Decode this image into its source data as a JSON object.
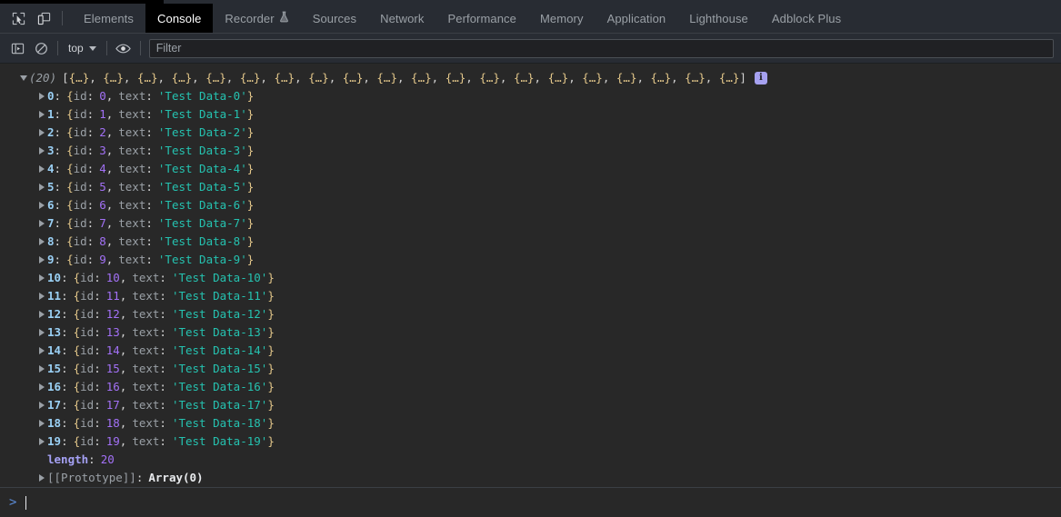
{
  "window": {
    "clipped_top_text": "······ ···· ········ ········ ······ ······ · ···· ········· ·· ·· ········ ····· ·······"
  },
  "tabbar": {
    "icons": [
      {
        "name": "inspect-element-icon",
        "label": "Inspect element"
      },
      {
        "name": "device-toolbar-icon",
        "label": "Toggle device toolbar"
      }
    ],
    "tabs": [
      {
        "label": "Elements",
        "active": false,
        "badge": ""
      },
      {
        "label": "Console",
        "active": true,
        "badge": ""
      },
      {
        "label": "Recorder",
        "active": false,
        "badge": "flask-icon"
      },
      {
        "label": "Sources",
        "active": false,
        "badge": ""
      },
      {
        "label": "Network",
        "active": false,
        "badge": ""
      },
      {
        "label": "Performance",
        "active": false,
        "badge": ""
      },
      {
        "label": "Memory",
        "active": false,
        "badge": ""
      },
      {
        "label": "Application",
        "active": false,
        "badge": ""
      },
      {
        "label": "Lighthouse",
        "active": false,
        "badge": ""
      },
      {
        "label": "Adblock Plus",
        "active": false,
        "badge": ""
      }
    ]
  },
  "toolbar": {
    "sidebar_toggle_icon": "show-console-sidebar-icon",
    "clear_icon": "clear-console-icon",
    "context_label": "top",
    "eye_icon": "create-live-expression-icon",
    "filter_placeholder": "Filter",
    "filter_value": ""
  },
  "console": {
    "array_header": {
      "count": "(20)",
      "open_bracket": "[",
      "close_bracket": "]",
      "preview_item": "{…}",
      "preview_separator": ", ",
      "preview_count": 20,
      "visible_preview_count": 20,
      "info_badge": "i",
      "expanded": true
    },
    "rows": [
      {
        "index": "0",
        "id": "0",
        "text": "Test Data-0"
      },
      {
        "index": "1",
        "id": "1",
        "text": "Test Data-1"
      },
      {
        "index": "2",
        "id": "2",
        "text": "Test Data-2"
      },
      {
        "index": "3",
        "id": "3",
        "text": "Test Data-3"
      },
      {
        "index": "4",
        "id": "4",
        "text": "Test Data-4"
      },
      {
        "index": "5",
        "id": "5",
        "text": "Test Data-5"
      },
      {
        "index": "6",
        "id": "6",
        "text": "Test Data-6"
      },
      {
        "index": "7",
        "id": "7",
        "text": "Test Data-7"
      },
      {
        "index": "8",
        "id": "8",
        "text": "Test Data-8"
      },
      {
        "index": "9",
        "id": "9",
        "text": "Test Data-9"
      },
      {
        "index": "10",
        "id": "10",
        "text": "Test Data-10"
      },
      {
        "index": "11",
        "id": "11",
        "text": "Test Data-11"
      },
      {
        "index": "12",
        "id": "12",
        "text": "Test Data-12"
      },
      {
        "index": "13",
        "id": "13",
        "text": "Test Data-13"
      },
      {
        "index": "14",
        "id": "14",
        "text": "Test Data-14"
      },
      {
        "index": "15",
        "id": "15",
        "text": "Test Data-15"
      },
      {
        "index": "16",
        "id": "16",
        "text": "Test Data-16"
      },
      {
        "index": "17",
        "id": "17",
        "text": "Test Data-17"
      },
      {
        "index": "18",
        "id": "18",
        "text": "Test Data-18"
      },
      {
        "index": "19",
        "id": "19",
        "text": "Test Data-19"
      }
    ],
    "key_id": "id",
    "key_text": "text",
    "length_label": "length",
    "length_value": "20",
    "prototype_label": "[[Prototype]]",
    "prototype_value": "Array(0)"
  },
  "prompt": {
    "chevron": ">",
    "value": ""
  },
  "colors": {
    "background": "#282828",
    "chrome": "#282c33",
    "active_tab_bg": "#000000",
    "string": "#25c2b0",
    "number": "#a371f7",
    "key": "#9aa0a6",
    "index": "#9ad0f5",
    "brace": "#e3c78a",
    "info_badge": "#a6a1f0",
    "prompt_chevron": "#5b8bd6"
  }
}
